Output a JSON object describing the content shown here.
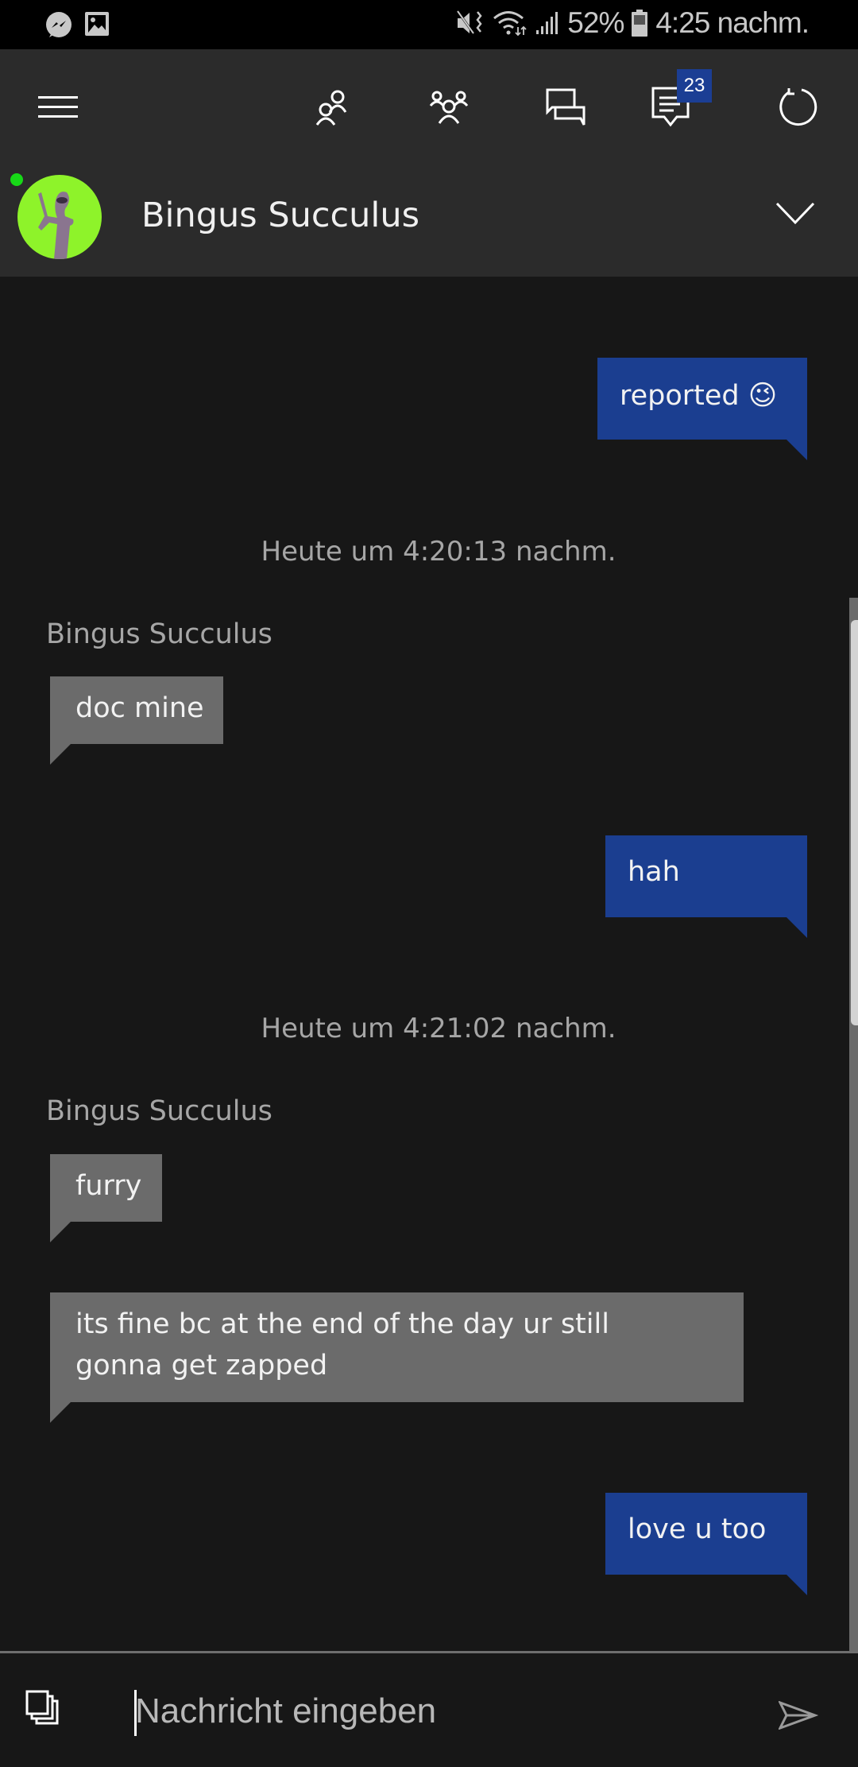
{
  "status_bar": {
    "left_icons": [
      "messenger-icon",
      "image-icon"
    ],
    "right_icons": [
      "mute-vibrate-icon",
      "wifi-icon",
      "signal-icon",
      "battery-icon"
    ],
    "battery_percent": "52%",
    "time": "4:25 nachm."
  },
  "toolbar": {
    "menu_icon": "hamburger-menu-icon",
    "buttons": [
      {
        "name": "friends",
        "icon": "friends-icon"
      },
      {
        "name": "party",
        "icon": "party-icon"
      },
      {
        "name": "conversations",
        "icon": "conversations-icon"
      },
      {
        "name": "messages",
        "icon": "messages-icon",
        "badge": "23"
      },
      {
        "name": "refresh",
        "icon": "refresh-icon"
      }
    ]
  },
  "contact": {
    "name": "Bingus Succulus",
    "status": "online",
    "status_color": "#17d917"
  },
  "messages": [
    {
      "from": "me",
      "text": "reported 😉"
    },
    {
      "type": "timestamp",
      "text": "Heute um 4:20:13 nachm."
    },
    {
      "type": "sender",
      "text": "Bingus Succulus"
    },
    {
      "from": "them",
      "text": "doc mine"
    },
    {
      "from": "me",
      "text": "hah"
    },
    {
      "type": "timestamp",
      "text": "Heute um 4:21:02 nachm."
    },
    {
      "type": "sender",
      "text": "Bingus Succulus"
    },
    {
      "from": "them",
      "text": "furry"
    },
    {
      "from": "them",
      "text": "its fine bc at the end of the day ur still\ngonna get zapped"
    },
    {
      "from": "me",
      "text": "love u too"
    }
  ],
  "composer": {
    "placeholder": "Nachricht eingeben",
    "value": ""
  },
  "colors": {
    "my_bubble": "#1b3e90",
    "their_bubble": "#6b6b6b",
    "background": "#171717",
    "header": "#2b2b2b",
    "badge": "#1b3e94"
  }
}
